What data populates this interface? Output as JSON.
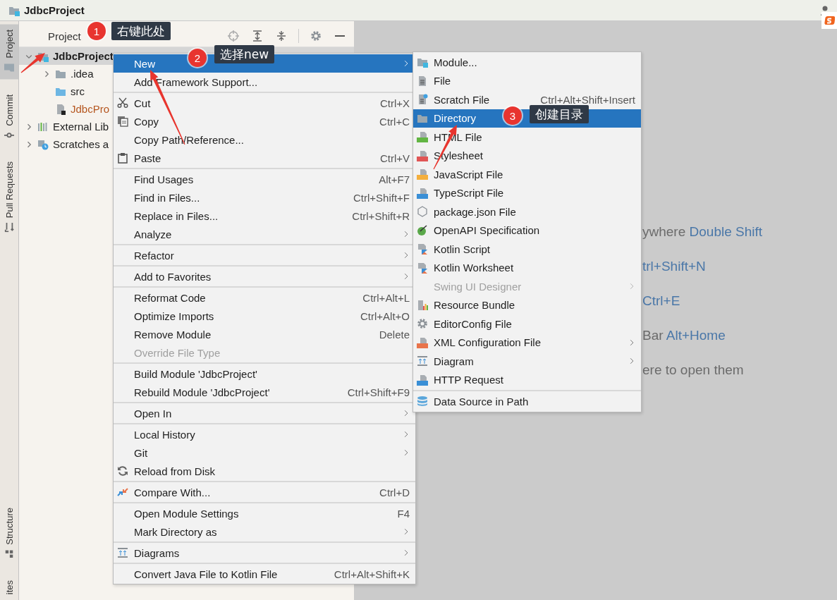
{
  "title_bar": {
    "project_name": "JdbcProject"
  },
  "tool_stripe": {
    "top": [
      {
        "label": "Project",
        "selected": true
      },
      {
        "label": "Commit",
        "selected": false
      },
      {
        "label": "Pull Requests",
        "selected": false
      }
    ],
    "bottom": [
      {
        "label": "Structure",
        "selected": false
      },
      {
        "label": "ites",
        "selected": false
      }
    ]
  },
  "project_panel": {
    "header": "Project",
    "tree": [
      {
        "label": "JdbcProject",
        "kind": "module",
        "expanded": true,
        "selected": true,
        "children": [
          {
            "label": ".idea",
            "kind": "folder",
            "expanded": false,
            "selected": false
          },
          {
            "label": "src",
            "kind": "source-folder",
            "selected": false
          },
          {
            "label": "JdbcPro",
            "kind": "module-file",
            "selected": false
          }
        ]
      },
      {
        "label": "External Lib",
        "kind": "library",
        "expanded": false,
        "selected": false
      },
      {
        "label": "Scratches a",
        "kind": "scratches",
        "expanded": false,
        "selected": false
      }
    ]
  },
  "editor": {
    "hints": [
      {
        "prefix": "ywhere",
        "shortcut": "Double Shift"
      },
      {
        "shortcut": "trl+Shift+N"
      },
      {
        "shortcut": "Ctrl+E"
      },
      {
        "prefix": "Bar",
        "shortcut": "Alt+Home"
      },
      {
        "prefix": "ere to open them"
      }
    ]
  },
  "context_menu": {
    "groups": [
      {
        "items": [
          {
            "label": "New",
            "submenu": true,
            "selected": true,
            "disabled": false
          },
          {
            "label": "Add Framework Support...",
            "submenu": false,
            "selected": false,
            "disabled": false
          }
        ]
      },
      {
        "items": [
          {
            "label": "Cut",
            "shortcut": "Ctrl+X",
            "submenu": false,
            "selected": false,
            "disabled": false
          },
          {
            "label": "Copy",
            "shortcut": "Ctrl+C",
            "submenu": false,
            "selected": false,
            "disabled": false
          },
          {
            "label": "Copy Path/Reference...",
            "submenu": false,
            "selected": false,
            "disabled": false
          },
          {
            "label": "Paste",
            "shortcut": "Ctrl+V",
            "submenu": false,
            "selected": false,
            "disabled": false
          }
        ]
      },
      {
        "items": [
          {
            "label": "Find Usages",
            "shortcut": "Alt+F7",
            "submenu": false,
            "selected": false,
            "disabled": false
          },
          {
            "label": "Find in Files...",
            "shortcut": "Ctrl+Shift+F",
            "submenu": false,
            "selected": false,
            "disabled": false
          },
          {
            "label": "Replace in Files...",
            "shortcut": "Ctrl+Shift+R",
            "submenu": false,
            "selected": false,
            "disabled": false
          },
          {
            "label": "Analyze",
            "submenu": true,
            "selected": false,
            "disabled": false
          }
        ]
      },
      {
        "items": [
          {
            "label": "Refactor",
            "submenu": true,
            "selected": false,
            "disabled": false
          }
        ]
      },
      {
        "items": [
          {
            "label": "Add to Favorites",
            "submenu": true,
            "selected": false,
            "disabled": false
          }
        ]
      },
      {
        "items": [
          {
            "label": "Reformat Code",
            "shortcut": "Ctrl+Alt+L",
            "submenu": false,
            "selected": false,
            "disabled": false
          },
          {
            "label": "Optimize Imports",
            "shortcut": "Ctrl+Alt+O",
            "submenu": false,
            "selected": false,
            "disabled": false
          },
          {
            "label": "Remove Module",
            "shortcut": "Delete",
            "submenu": false,
            "selected": false,
            "disabled": false
          },
          {
            "label": "Override File Type",
            "submenu": false,
            "selected": false,
            "disabled": true
          }
        ]
      },
      {
        "items": [
          {
            "label": "Build Module 'JdbcProject'",
            "submenu": false,
            "selected": false,
            "disabled": false
          },
          {
            "label": "Rebuild Module 'JdbcProject'",
            "shortcut": "Ctrl+Shift+F9",
            "submenu": false,
            "selected": false,
            "disabled": false
          }
        ]
      },
      {
        "items": [
          {
            "label": "Open In",
            "submenu": true,
            "selected": false,
            "disabled": false
          }
        ]
      },
      {
        "items": [
          {
            "label": "Local History",
            "submenu": true,
            "selected": false,
            "disabled": false
          },
          {
            "label": "Git",
            "submenu": true,
            "selected": false,
            "disabled": false
          },
          {
            "label": "Reload from Disk",
            "submenu": false,
            "selected": false,
            "disabled": false
          }
        ]
      },
      {
        "items": [
          {
            "label": "Compare With...",
            "shortcut": "Ctrl+D",
            "submenu": false,
            "selected": false,
            "disabled": false
          }
        ]
      },
      {
        "items": [
          {
            "label": "Open Module Settings",
            "shortcut": "F4",
            "submenu": false,
            "selected": false,
            "disabled": false
          },
          {
            "label": "Mark Directory as",
            "submenu": true,
            "selected": false,
            "disabled": false
          }
        ]
      },
      {
        "items": [
          {
            "label": "Diagrams",
            "submenu": true,
            "selected": false,
            "disabled": false
          }
        ]
      },
      {
        "items": [
          {
            "label": "Convert Java File to Kotlin File",
            "shortcut": "Ctrl+Alt+Shift+K",
            "submenu": false,
            "selected": false,
            "disabled": false
          }
        ]
      }
    ]
  },
  "new_submenu": {
    "groups": [
      {
        "items": [
          {
            "label": "Module...",
            "submenu": false,
            "selected": false,
            "disabled": false
          },
          {
            "label": "File",
            "submenu": false,
            "selected": false,
            "disabled": false
          },
          {
            "label": "Scratch File",
            "shortcut": "Ctrl+Alt+Shift+Insert",
            "submenu": false,
            "selected": false,
            "disabled": false
          },
          {
            "label": "Directory",
            "submenu": false,
            "selected": true,
            "disabled": false
          },
          {
            "label": "HTML File",
            "submenu": false,
            "selected": false,
            "disabled": false
          },
          {
            "label": "Stylesheet",
            "submenu": false,
            "selected": false,
            "disabled": false
          },
          {
            "label": "JavaScript File",
            "submenu": false,
            "selected": false,
            "disabled": false
          },
          {
            "label": "TypeScript File",
            "submenu": false,
            "selected": false,
            "disabled": false
          },
          {
            "label": "package.json File",
            "submenu": false,
            "selected": false,
            "disabled": false
          },
          {
            "label": "OpenAPI Specification",
            "submenu": false,
            "selected": false,
            "disabled": false
          },
          {
            "label": "Kotlin Script",
            "submenu": false,
            "selected": false,
            "disabled": false
          },
          {
            "label": "Kotlin Worksheet",
            "submenu": false,
            "selected": false,
            "disabled": false
          },
          {
            "label": "Swing UI Designer",
            "submenu": true,
            "selected": false,
            "disabled": true
          },
          {
            "label": "Resource Bundle",
            "submenu": false,
            "selected": false,
            "disabled": false
          },
          {
            "label": "EditorConfig File",
            "submenu": false,
            "selected": false,
            "disabled": false
          },
          {
            "label": "XML Configuration File",
            "submenu": true,
            "selected": false,
            "disabled": false
          },
          {
            "label": "Diagram",
            "submenu": true,
            "selected": false,
            "disabled": false
          },
          {
            "label": "HTTP Request",
            "submenu": false,
            "selected": false,
            "disabled": false
          }
        ]
      },
      {
        "items": [
          {
            "label": "Data Source in Path",
            "submenu": false,
            "selected": false,
            "disabled": false
          }
        ]
      }
    ]
  },
  "annotations": [
    {
      "number": "1",
      "text": "右键此处"
    },
    {
      "number": "2",
      "text": "选择new"
    },
    {
      "number": "3",
      "text": "创建目录"
    }
  ]
}
